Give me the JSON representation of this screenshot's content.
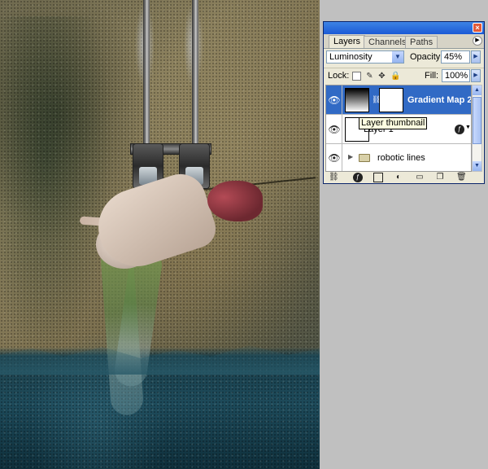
{
  "panel": {
    "tabs": [
      {
        "label": "Layers",
        "active": true
      },
      {
        "label": "Channels",
        "active": false
      },
      {
        "label": "Paths",
        "active": false
      }
    ],
    "blend_mode": "Luminosity",
    "opacity_label": "Opacity:",
    "opacity_value": "45%",
    "lock_label": "Lock:",
    "fill_label": "Fill:",
    "fill_value": "100%",
    "layers": [
      {
        "name": "Gradient Map 2",
        "selected": true,
        "type": "adjustment",
        "visible": true
      },
      {
        "name": "Layer 1",
        "selected": false,
        "type": "pixel",
        "visible": true
      },
      {
        "name": "robotic lines",
        "selected": false,
        "type": "group",
        "visible": true
      }
    ],
    "tooltip": "Layer thumbnail",
    "accent_color": "#316ac5",
    "titlebar_color": "#1b5ad6"
  },
  "icons": {
    "close": "close-icon",
    "panel_menu": "panel-menu-icon",
    "eye": "eye-icon",
    "lock_transparent": "lock-transparent-icon",
    "lock_image": "lock-image-icon",
    "lock_position": "lock-position-icon",
    "lock_all": "lock-all-icon",
    "link_layers": "link-icon",
    "layer_style": "fx-icon",
    "mask": "mask-icon",
    "adjustment": "adjustment-icon",
    "new_group": "folder-icon",
    "new_layer": "new-layer-icon",
    "delete": "trash-icon"
  }
}
